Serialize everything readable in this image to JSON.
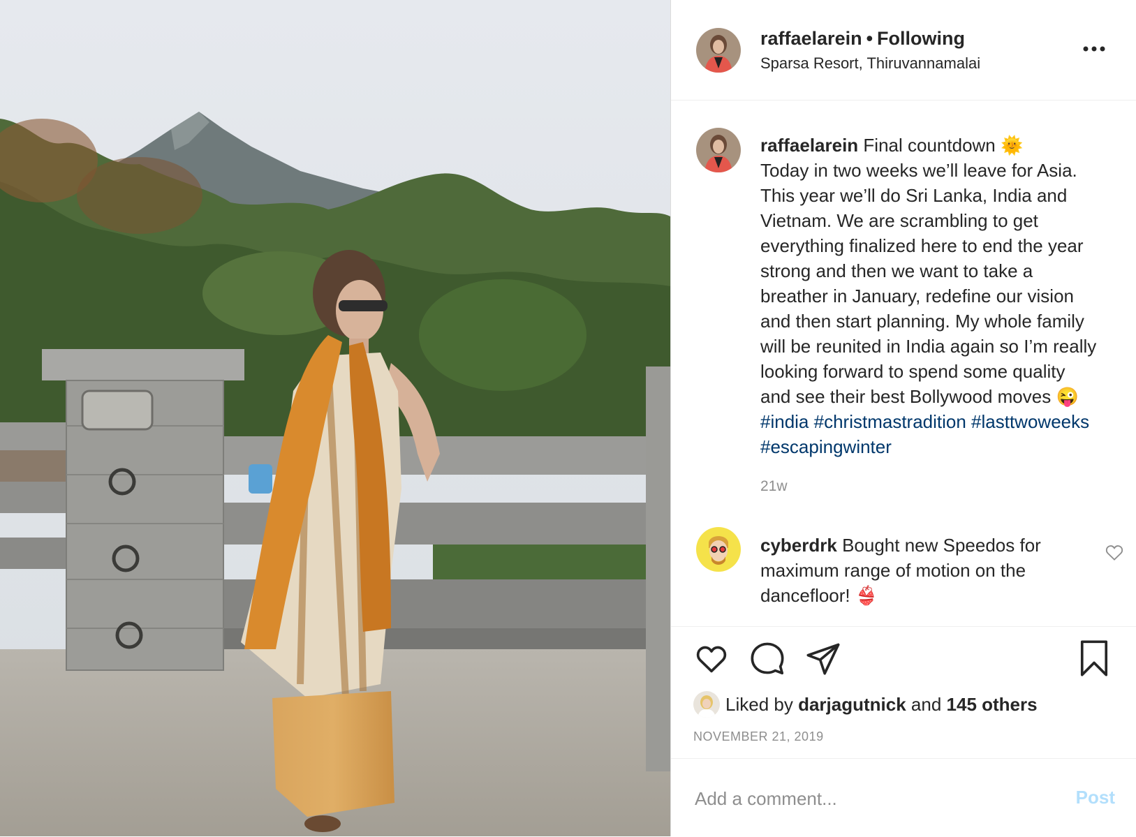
{
  "post": {
    "username": "raffaelarein",
    "follow_status": "Following",
    "location": "Sparsa Resort, Thiruvannamalai",
    "more_icon": "more-horizontal-icon"
  },
  "caption": {
    "username": "raffaelarein",
    "text_lines": [
      "Final countdown 🌞",
      "Today in two weeks we’ll leave for Asia.",
      "This year we’ll do Sri Lanka, India and",
      "Vietnam. We are scrambling to get",
      "everything finalized here to end the year",
      "strong and then we want to take a",
      "breather in January, redefine our vision",
      "and then start planning. My whole family",
      "will be reunited in India again so I’m really",
      "looking forward to spend some quality",
      "and see their best Bollywood moves 😜"
    ],
    "hashtags_line1": "#india #christmastradition #lasttwoweeks",
    "hashtags_line2": "#escapingwinter",
    "time_ago": "21w"
  },
  "comments": [
    {
      "username": "cyberdrk",
      "text": "Bought new Speedos for maximum range of motion on the dancefloor! 👙"
    }
  ],
  "likes": {
    "prefix": "Liked by",
    "user": "darjagutnick",
    "conjunction": "and",
    "others": "145 others"
  },
  "date": "NOVEMBER 21, 2019",
  "add_comment": {
    "placeholder": "Add a comment...",
    "post_label": "Post"
  },
  "icons": [
    "heart-icon",
    "comment-icon",
    "share-icon",
    "bookmark-icon",
    "more-horizontal-icon",
    "comment-heart-icon"
  ],
  "colors": {
    "text": "#262626",
    "secondary": "#8e8e8e",
    "hashtag": "#00376b",
    "post_button_disabled": "#b2dffc",
    "divider": "#efefef"
  }
}
